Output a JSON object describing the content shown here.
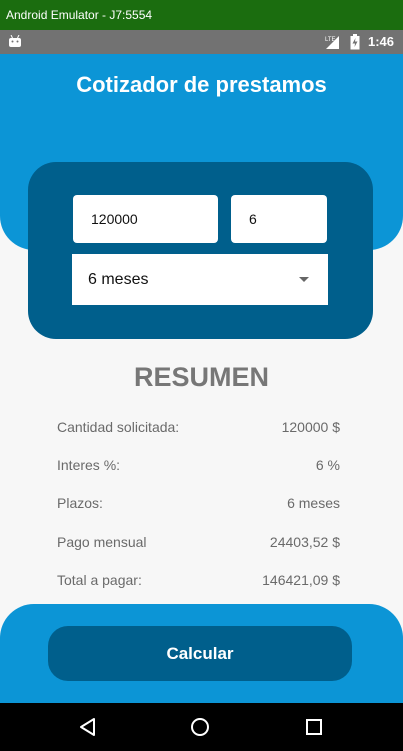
{
  "window": {
    "title": "Android Emulator - J7:5554"
  },
  "status_bar": {
    "time": "1:46",
    "network": "LTE"
  },
  "header": {
    "title": "Cotizador de prestamos"
  },
  "form": {
    "amount_value": "120000",
    "rate_value": "6",
    "term_selected": "6 meses"
  },
  "summary": {
    "title": "RESUMEN",
    "rows": [
      {
        "label": "Cantidad solicitada:",
        "value": "120000 $"
      },
      {
        "label": "Interes %:",
        "value": "6 %"
      },
      {
        "label": "Plazos:",
        "value": "6 meses"
      },
      {
        "label": "Pago mensual",
        "value": "24403,52 $"
      },
      {
        "label": "Total a pagar:",
        "value": "146421,09 $"
      }
    ]
  },
  "footer": {
    "calculate_label": "Calcular"
  },
  "colors": {
    "primary": "#0c95d6",
    "primary_dark": "#005f8c",
    "titlebar": "#1b6d0f"
  },
  "icons": {
    "status_left": "android-icon",
    "network": "lte-signal-icon",
    "battery": "battery-charging-icon",
    "nav_back": "back-triangle-icon",
    "nav_home": "home-circle-icon",
    "nav_recents": "recents-square-icon"
  }
}
